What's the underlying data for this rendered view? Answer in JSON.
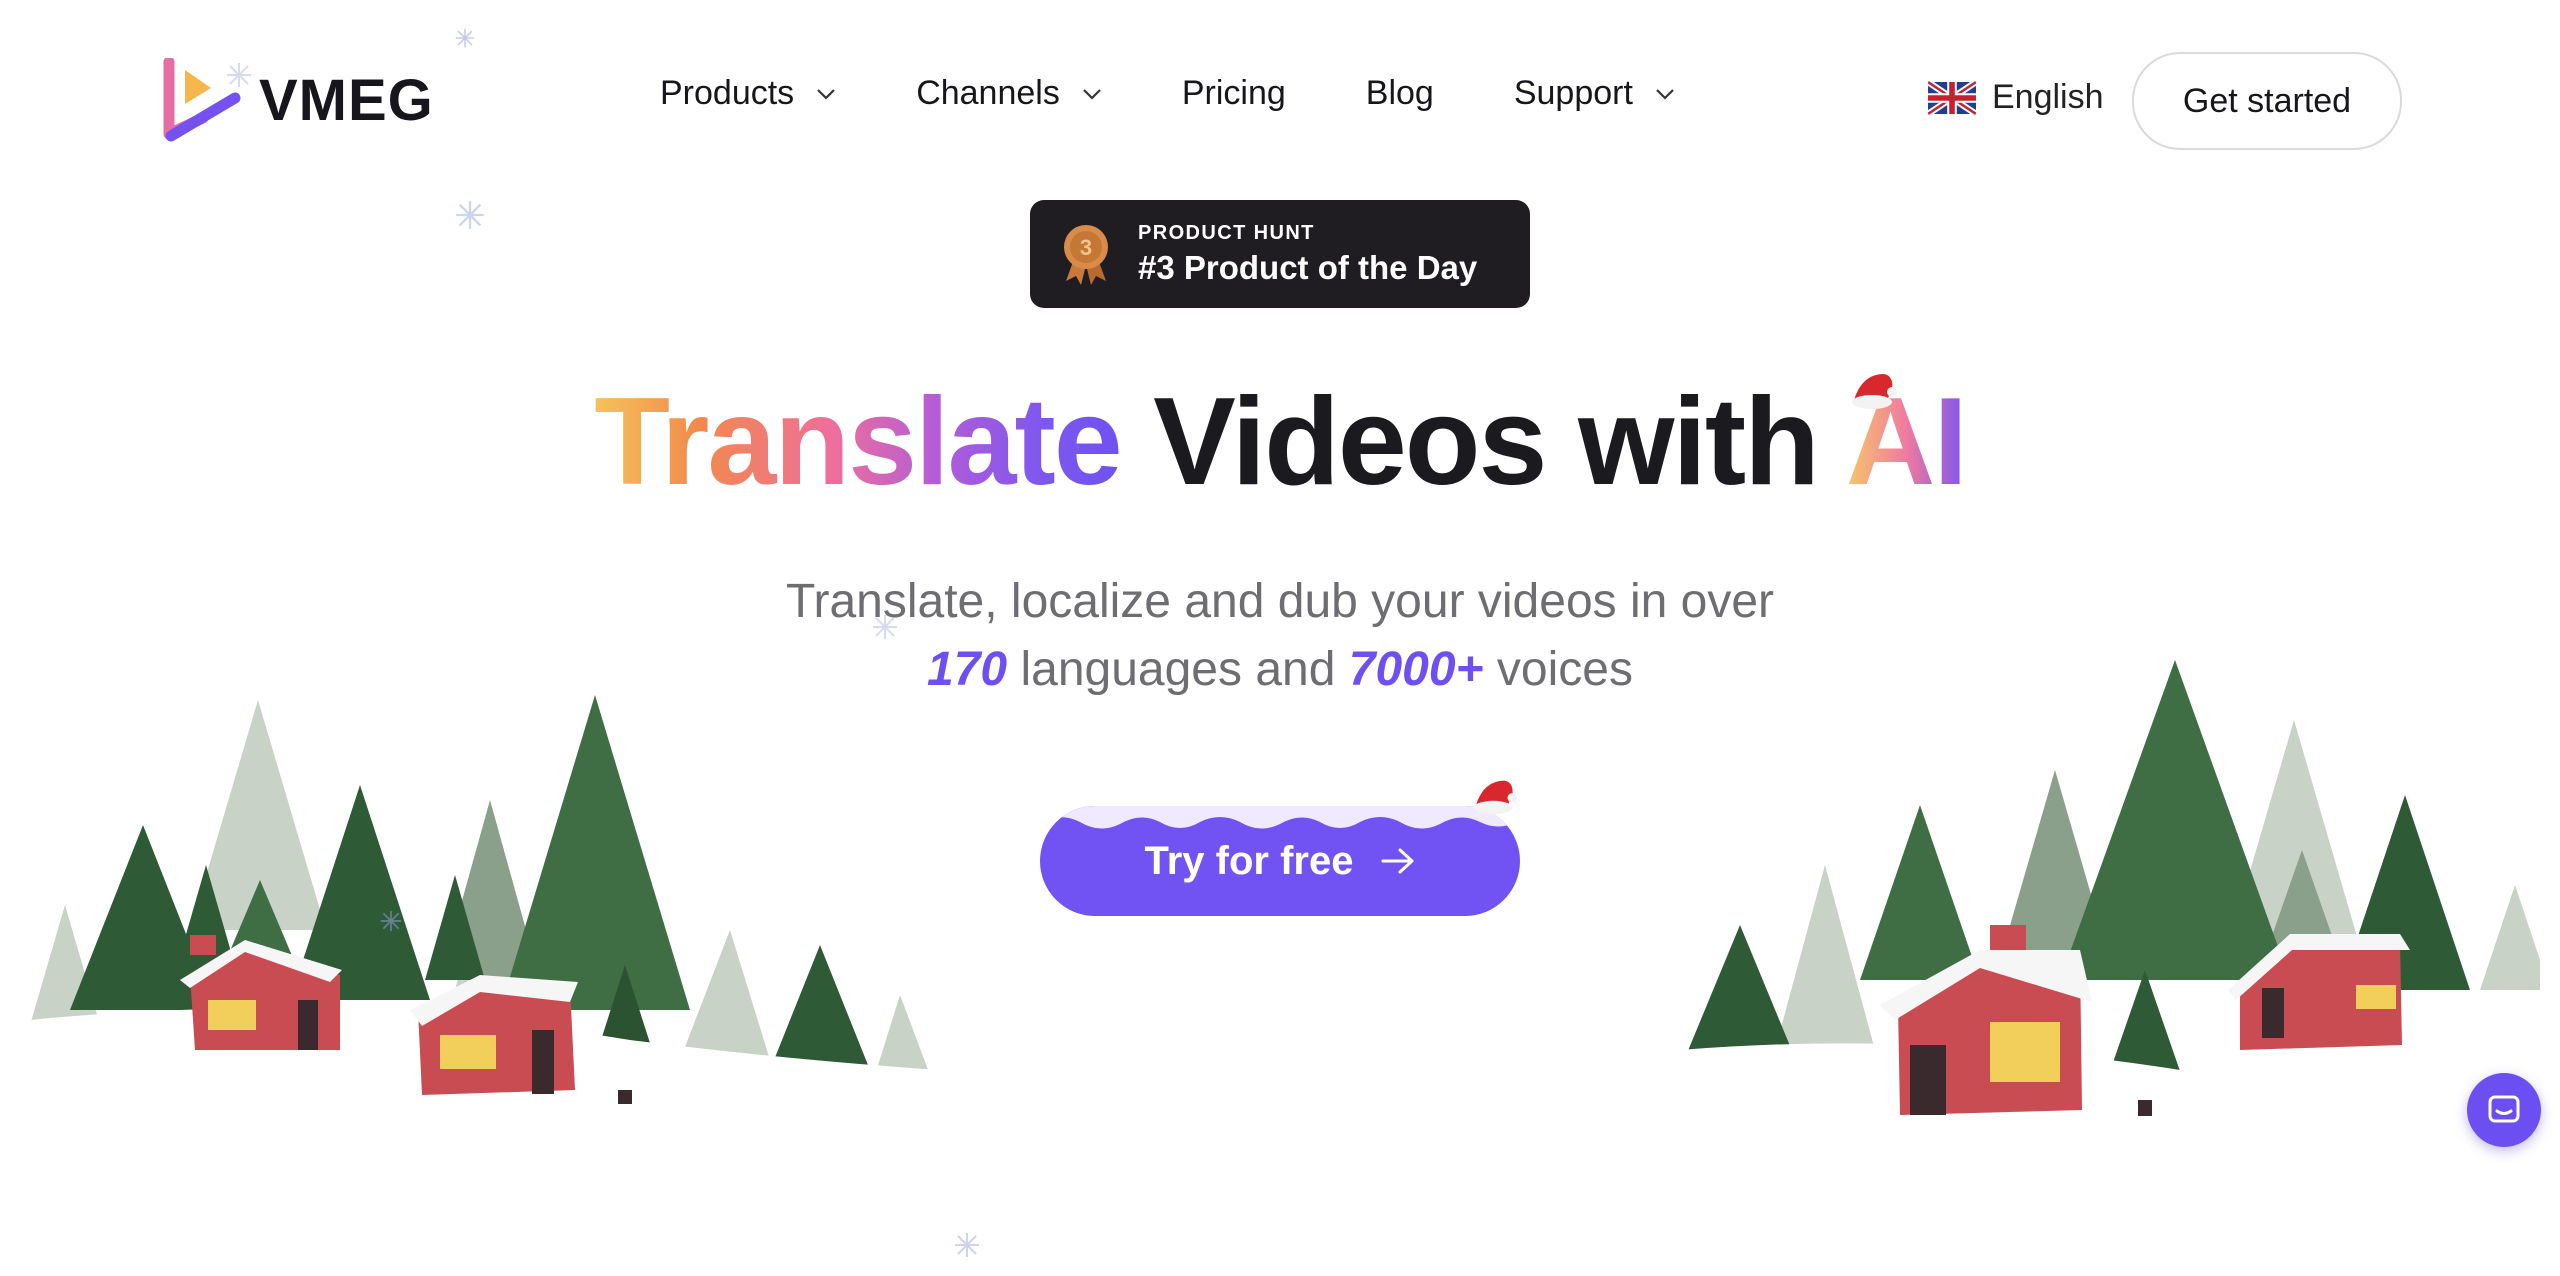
{
  "brand": {
    "name": "VMEG",
    "logo_icon": "play-logo-icon"
  },
  "nav": {
    "items": [
      {
        "label": "Products",
        "has_dropdown": true
      },
      {
        "label": "Channels",
        "has_dropdown": true
      },
      {
        "label": "Pricing",
        "has_dropdown": false
      },
      {
        "label": "Blog",
        "has_dropdown": false
      },
      {
        "label": "Support",
        "has_dropdown": true
      }
    ],
    "language": {
      "label": "English",
      "flag_icon": "uk-flag-icon"
    },
    "cta_label": "Get started"
  },
  "badge": {
    "overline": "PRODUCT HUNT",
    "title": "#3 Product of the Day",
    "medal_number": "3"
  },
  "hero": {
    "title_gradient": "Translate",
    "title_middle": "Videos with",
    "title_ai": "AI",
    "subtitle_line1": "Translate, localize and dub your videos in over",
    "languages_count": "170",
    "subtitle_mid": "languages and",
    "voices_count": "7000+",
    "subtitle_end": "voices",
    "cta_label": "Try for free"
  },
  "colors": {
    "accent": "#7152f3",
    "badge_bg": "#1f1d22",
    "tree_dark": "#2f5a36",
    "tree_light": "#c8d2c6",
    "house": "#c94c52"
  }
}
